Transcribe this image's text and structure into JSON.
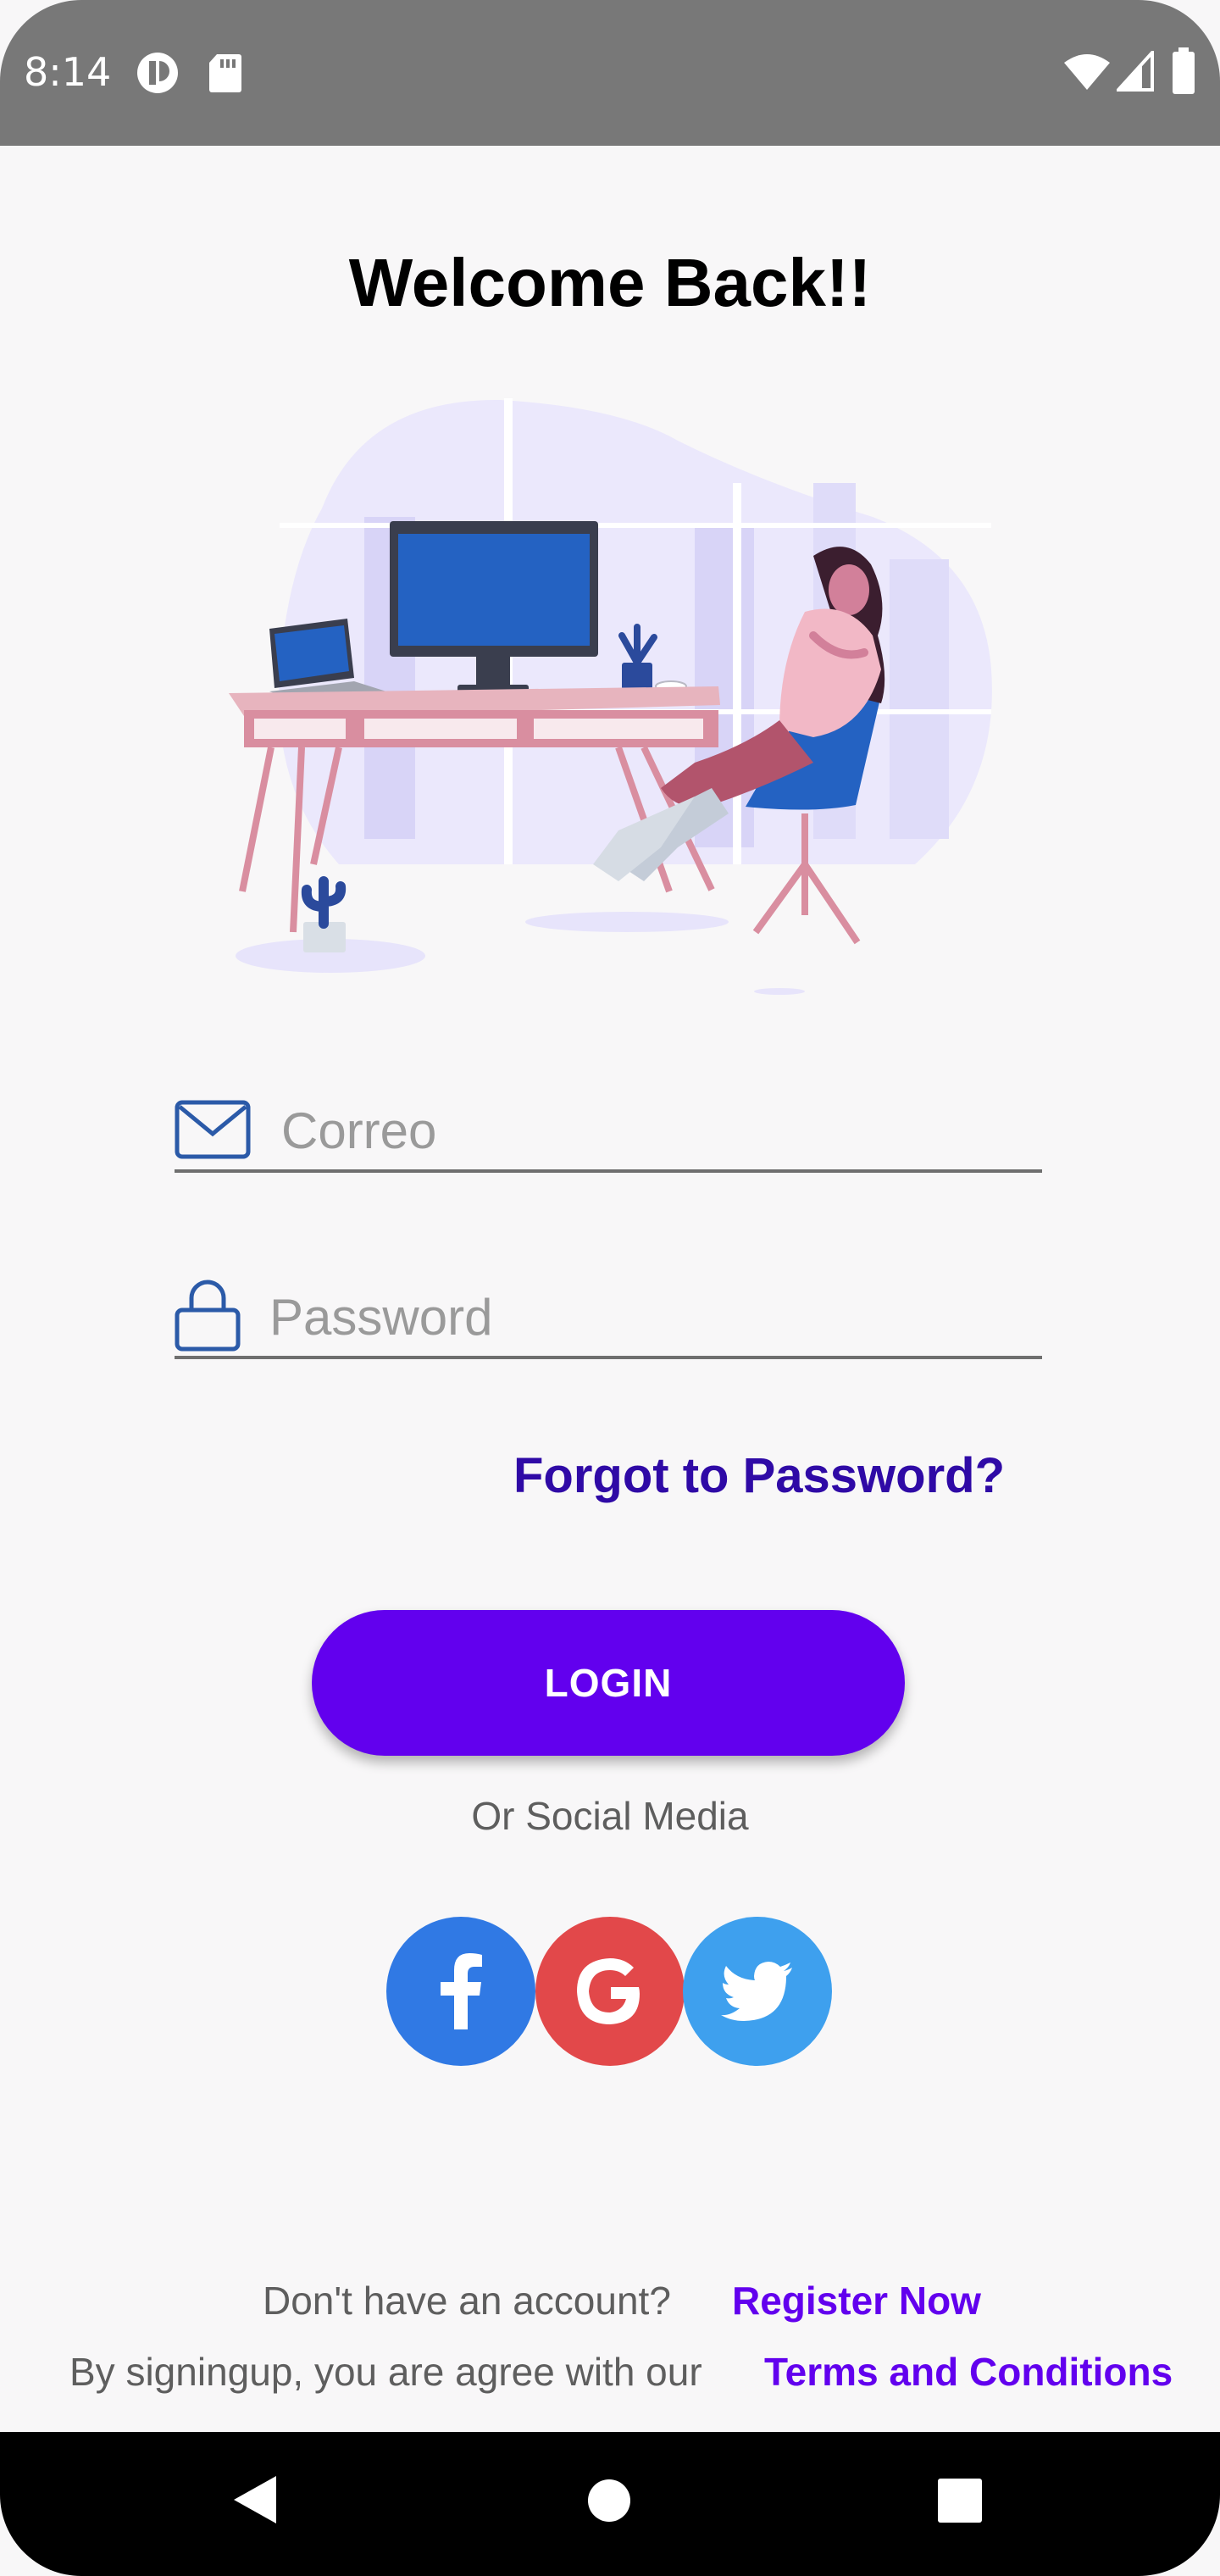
{
  "status_bar": {
    "time": "8:14",
    "icons_left": [
      "privacy-indicator-icon",
      "sd-card-icon"
    ],
    "icons_right": [
      "wifi-icon",
      "cell-signal-icon",
      "battery-icon"
    ]
  },
  "page": {
    "title": "Welcome Back!!",
    "illustration": "woman-at-desk-illustration"
  },
  "form": {
    "email": {
      "icon": "mail-icon",
      "placeholder": "Correo",
      "value": ""
    },
    "password": {
      "icon": "lock-icon",
      "placeholder": "Password",
      "value": ""
    },
    "forgot_label": "Forgot to Password?",
    "login_label": "LOGIN"
  },
  "social": {
    "label": "Or Social Media",
    "buttons": [
      {
        "icon": "facebook-icon",
        "color": "#3079e4"
      },
      {
        "icon": "google-icon",
        "color": "#e2484a"
      },
      {
        "icon": "twitter-icon",
        "color": "#3ea0ee"
      }
    ]
  },
  "footer": {
    "no_account_text": "Don't have an account?",
    "register_label": "Register Now",
    "terms_text": "By signingup, you are agree with our",
    "terms_link": "Terms and Conditions"
  },
  "colors": {
    "primary": "#6200ee",
    "forgot_link": "#2f0aa6",
    "background": "#f8f7f8",
    "status_bar": "#787878"
  },
  "nav_bar": {
    "icons": [
      "back-icon",
      "home-icon",
      "recents-icon"
    ]
  }
}
